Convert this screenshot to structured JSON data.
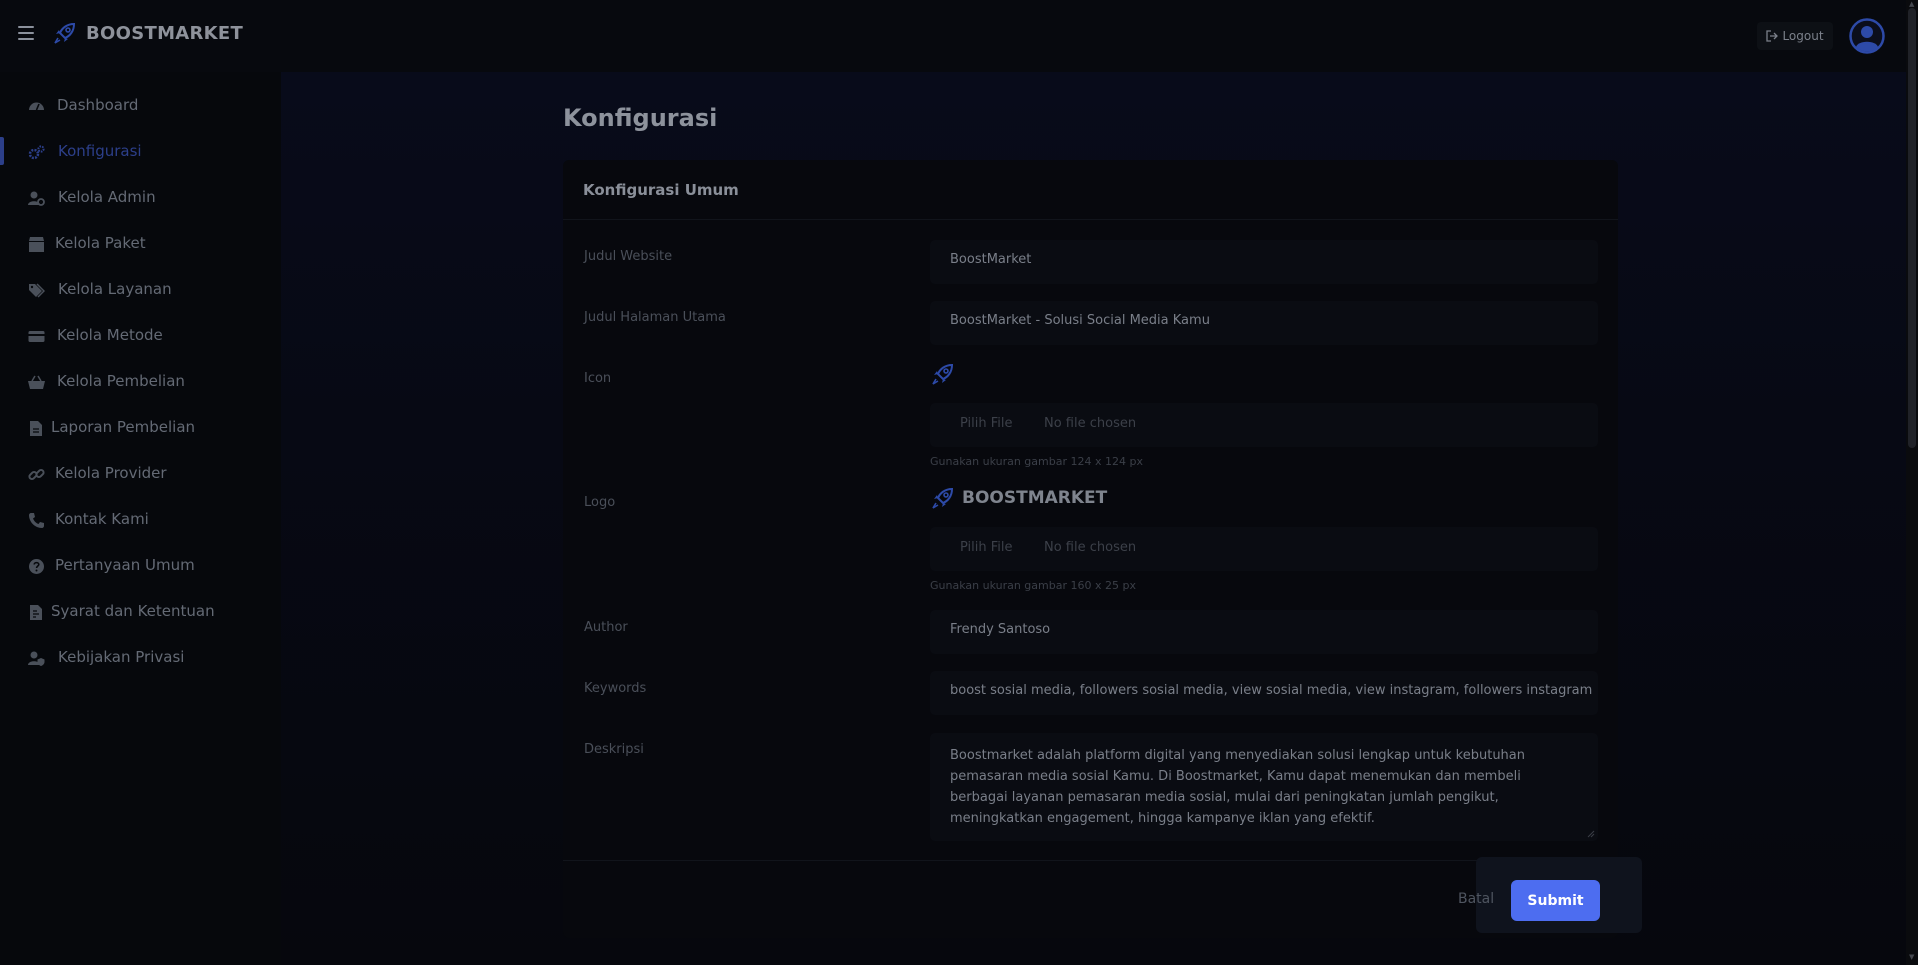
{
  "brand": {
    "name": "BOOSTMARKET"
  },
  "topbar": {
    "logout_label": "Logout"
  },
  "sidebar": {
    "items": [
      {
        "label": "Dashboard",
        "icon": "dashboard-icon"
      },
      {
        "label": "Konfigurasi",
        "icon": "cogs-icon",
        "active": true
      },
      {
        "label": "Kelola Admin",
        "icon": "user-cog-icon"
      },
      {
        "label": "Kelola Paket",
        "icon": "box-icon"
      },
      {
        "label": "Kelola Layanan",
        "icon": "tags-icon"
      },
      {
        "label": "Kelola Metode",
        "icon": "credit-card-icon"
      },
      {
        "label": "Kelola Pembelian",
        "icon": "basket-icon"
      },
      {
        "label": "Laporan Pembelian",
        "icon": "file-icon"
      },
      {
        "label": "Kelola Provider",
        "icon": "link-icon"
      },
      {
        "label": "Kontak Kami",
        "icon": "phone-icon"
      },
      {
        "label": "Pertanyaan Umum",
        "icon": "question-icon"
      },
      {
        "label": "Syarat dan Ketentuan",
        "icon": "file-contract-icon"
      },
      {
        "label": "Kebijakan Privasi",
        "icon": "user-shield-icon"
      }
    ]
  },
  "page": {
    "title": "Konfigurasi"
  },
  "card": {
    "title": "Konfigurasi Umum"
  },
  "form": {
    "judul_website": {
      "label": "Judul Website",
      "value": "BoostMarket"
    },
    "judul_halaman": {
      "label": "Judul Halaman Utama",
      "value": "BoostMarket - Solusi Social Media Kamu"
    },
    "icon": {
      "label": "Icon",
      "file_button": "Pilih File",
      "file_status": "No file chosen",
      "hint": "Gunakan ukuran gambar 124 x 124 px"
    },
    "logo": {
      "label": "Logo",
      "preview_text": "BOOSTMARKET",
      "file_button": "Pilih File",
      "file_status": "No file chosen",
      "hint": "Gunakan ukuran gambar 160 x 25 px"
    },
    "author": {
      "label": "Author",
      "value": "Frendy Santoso"
    },
    "keywords": {
      "label": "Keywords",
      "value": "boost sosial media, followers sosial media, view sosial media, view instagram, followers instagram"
    },
    "deskripsi": {
      "label": "Deskripsi",
      "value": "Boostmarket adalah platform digital yang menyediakan solusi lengkap untuk kebutuhan pemasaran media sosial Kamu. Di Boostmarket, Kamu dapat menemukan dan membeli berbagai layanan pemasaran media sosial, mulai dari peningkatan jumlah pengikut, meningkatkan engagement, hingga kampanye iklan yang efektif."
    }
  },
  "actions": {
    "cancel_label": "Batal",
    "submit_label": "Submit"
  },
  "colors": {
    "accent": "#4d6df0",
    "active_nav": "#2c3f8a",
    "background": "#05070c"
  }
}
